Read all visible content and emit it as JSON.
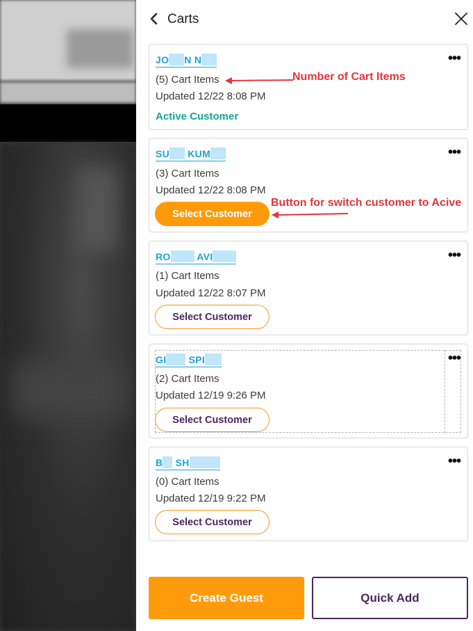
{
  "panel": {
    "title": "Carts"
  },
  "carts": [
    {
      "name_parts": [
        "JO",
        "N N"
      ],
      "items": "(5) Cart Items",
      "updated": "Updated 12/22 8:08 PM",
      "status": "Active Customer"
    },
    {
      "name_parts": [
        "SU",
        "KUM"
      ],
      "items": "(3) Cart Items",
      "updated": "Updated 12/22 8:08 PM",
      "button": "Select Customer"
    },
    {
      "name_parts": [
        "RO",
        "AVI"
      ],
      "items": "(1) Cart Items",
      "updated": "Updated 12/22 8:07 PM",
      "button": "Select Customer"
    },
    {
      "name_parts": [
        "GI",
        "SPI"
      ],
      "items": "(2) Cart Items",
      "updated": "Updated 12/19 9:26 PM",
      "button": "Select Customer"
    },
    {
      "name_parts": [
        "B",
        "SH"
      ],
      "items": "(0) Cart Items",
      "updated": "Updated 12/19 9:22 PM",
      "button": "Select Customer"
    }
  ],
  "annotations": {
    "cart_items": "Number of Cart Items",
    "switch_button": "Button for switch customer to Acive"
  },
  "footer": {
    "create_guest": "Create Guest",
    "quick_add": "Quick Add"
  },
  "colors": {
    "accent_orange": "#ff9b0a",
    "link_blue": "#1aa3d8",
    "active_green": "#14a39a",
    "brand_purple": "#4d2560",
    "annotation_red": "#e3353c"
  }
}
